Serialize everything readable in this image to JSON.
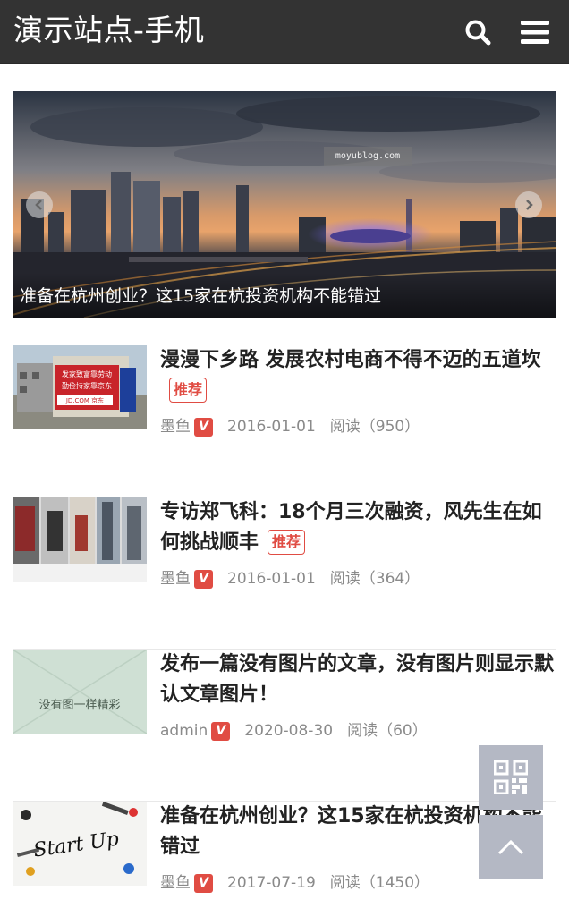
{
  "header": {
    "title": "演示站点-手机",
    "search_icon": "search-icon",
    "menu_icon": "menu-icon"
  },
  "slider": {
    "watermark": "moyublog.com",
    "caption": "准备在杭州创业？这15家在杭投资机构不能错过",
    "prev_icon": "chevron-left-icon",
    "next_icon": "chevron-right-icon"
  },
  "posts": [
    {
      "title": "漫漫下乡路 发展农村电商不得不迈的五道坎",
      "badge": "推荐",
      "author": "墨鱼",
      "vip": "V",
      "date": "2016-01-01",
      "views": "阅读（950）",
      "thumb_text": [
        "发家致富靠劳动",
        "勤俭持家靠京东",
        "JD.COM 京东"
      ]
    },
    {
      "title": "专访郑飞科：18个月三次融资，风先生在如何挑战顺丰",
      "badge": "推荐",
      "author": "墨鱼",
      "vip": "V",
      "date": "2016-01-01",
      "views": "阅读（364）"
    },
    {
      "title": "发布一篇没有图片的文章，没有图片则显示默认文章图片！",
      "badge": "",
      "author": "admin",
      "vip": "V",
      "date": "2020-08-30",
      "views": "阅读（60）",
      "thumb_text": "没有图一样精彩"
    },
    {
      "title": "准备在杭州创业？这15家在杭投资机构不能错过",
      "badge": "",
      "author": "墨鱼",
      "vip": "V",
      "date": "2017-07-19",
      "views": "阅读（1450）",
      "thumb_text": "Start Up"
    }
  ],
  "floating": {
    "qr_icon": "qr-code-icon",
    "top_icon": "chevron-up-icon"
  },
  "colors": {
    "header_bg": "#333333",
    "accent_red": "#e04c43",
    "float_bg": "#b4b8c4"
  }
}
